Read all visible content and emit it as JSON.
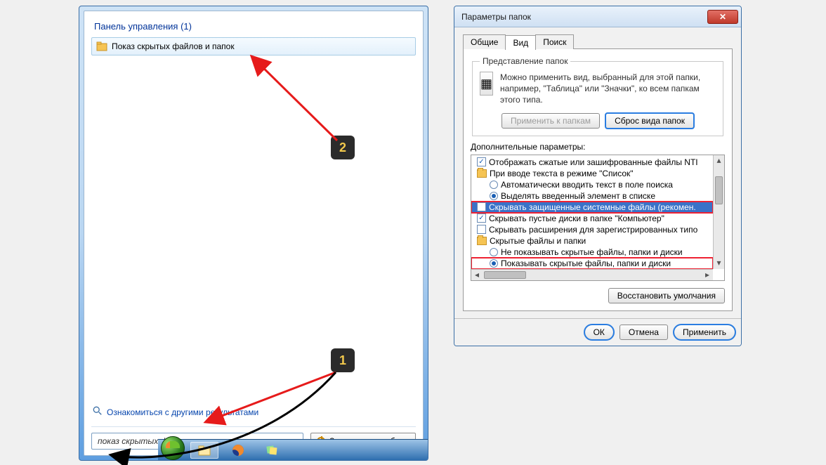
{
  "start_menu": {
    "heading_text": "Панель управления",
    "heading_count": "(1)",
    "result_label": "Показ скрытых файлов и папок",
    "more_results": "Ознакомиться с другими результатами",
    "search_value": "показ скрытых файлов и папок",
    "clear_symbol": "×",
    "shutdown_label": "Завершение работы"
  },
  "dialog": {
    "title": "Параметры папок",
    "close_symbol": "✕",
    "tabs": {
      "general": "Общие",
      "view": "Вид",
      "search": "Поиск"
    },
    "group_legend": "Представление папок",
    "view_desc": "Можно применить вид, выбранный для этой папки, например, \"Таблица\" или \"Значки\", ко всем папкам этого типа.",
    "apply_to_folders": "Применить к папкам",
    "reset_folders": "Сброс вида папок",
    "advanced_label": "Дополнительные параметры:",
    "tree": {
      "t0": "Отображать сжатые или зашифрованные файлы NTI",
      "t1": "При вводе текста в режиме \"Список\"",
      "t2": "Автоматически вводить текст в поле поиска",
      "t3": "Выделять введенный элемент в списке",
      "t4": "Скрывать защищенные системные файлы (рекомен.",
      "t5": "Скрывать пустые диски в папке \"Компьютер\"",
      "t6": "Скрывать расширения для зарегистрированных типо",
      "t7": "Скрытые файлы и папки",
      "t8": "Не показывать скрытые файлы, папки и диски",
      "t9": "Показывать скрытые файлы, папки и диски"
    },
    "restore_defaults": "Восстановить умолчания",
    "ok": "ОК",
    "cancel": "Отмена",
    "apply": "Применить"
  },
  "callouts": {
    "one": "1",
    "two": "2"
  }
}
